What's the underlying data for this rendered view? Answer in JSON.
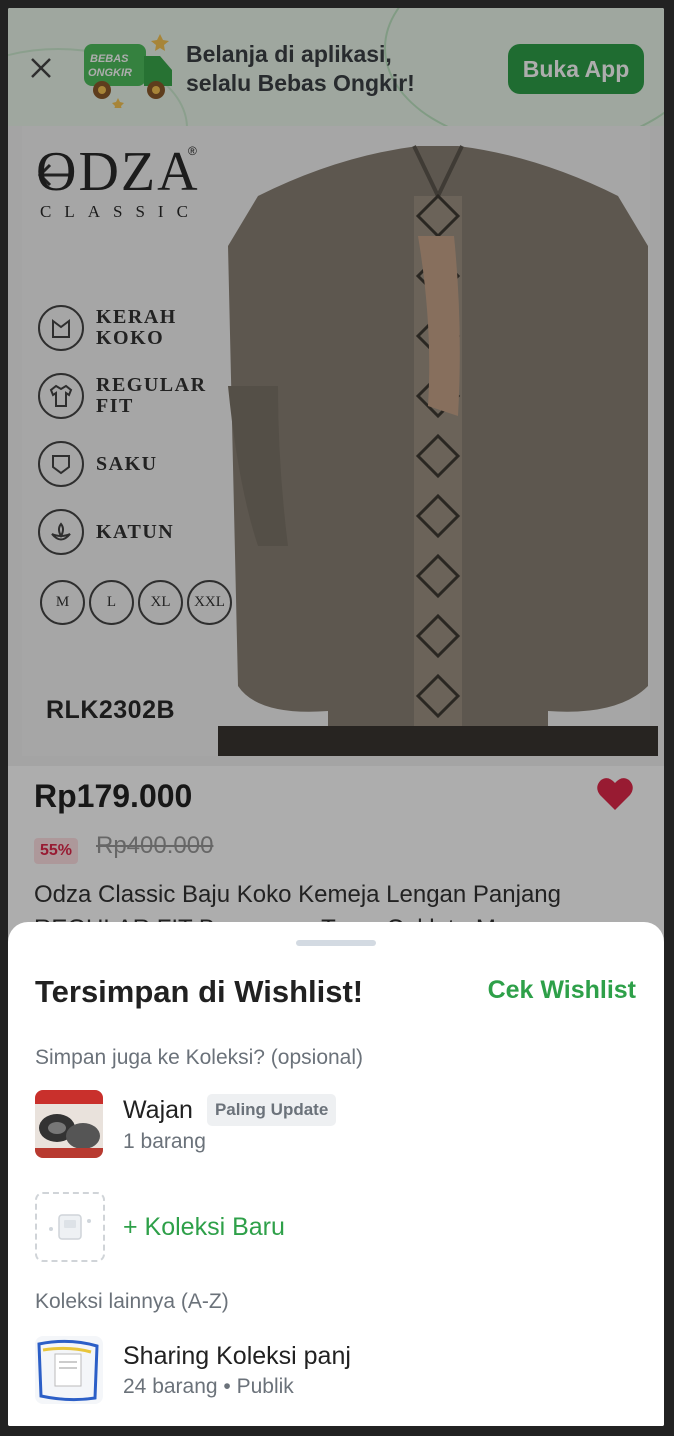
{
  "promo": {
    "truck_text_line1": "BEBAS",
    "truck_text_line2": "ONGKIR",
    "line1": "Belanja di aplikasi,",
    "line2": "selalu Bebas Ongkir!",
    "button": "Buka App"
  },
  "product_image": {
    "brand": "ODZA",
    "brand_sub": "CLASSIC",
    "registered": "®",
    "features": [
      "Kerah Koko",
      "Regular Fit",
      "Saku",
      "Katun"
    ],
    "features_lines": [
      [
        "Kerah",
        "Koko"
      ],
      [
        "Regular",
        "Fit"
      ],
      [
        "Saku"
      ],
      [
        "Katun"
      ]
    ],
    "sizes": [
      "M",
      "L",
      "XL",
      "XXL"
    ],
    "sku": "RLK2302B"
  },
  "product": {
    "price": "Rp179.000",
    "discount": "55%",
    "old_price": "Rp400.000",
    "title": "Odza Classic Baju Koko Kemeja Lengan Panjang REGULAR FIT Bermacam Tema Coklat - M"
  },
  "sheet": {
    "title": "Tersimpan di Wishlist!",
    "action": "Cek Wishlist",
    "subtitle": "Simpan juga ke Koleksi? (opsional)",
    "collections": [
      {
        "name": "Wajan",
        "badge": "Paling Update",
        "meta": "1 barang"
      }
    ],
    "new_collection": "+ Koleksi Baru",
    "others_label": "Koleksi lainnya (A-Z)",
    "others": [
      {
        "name": "Sharing Koleksi panj",
        "meta": "24 barang • Publik"
      }
    ]
  },
  "colors": {
    "accent_green": "#2ea049",
    "wishlist_heart": "#e0284a"
  }
}
